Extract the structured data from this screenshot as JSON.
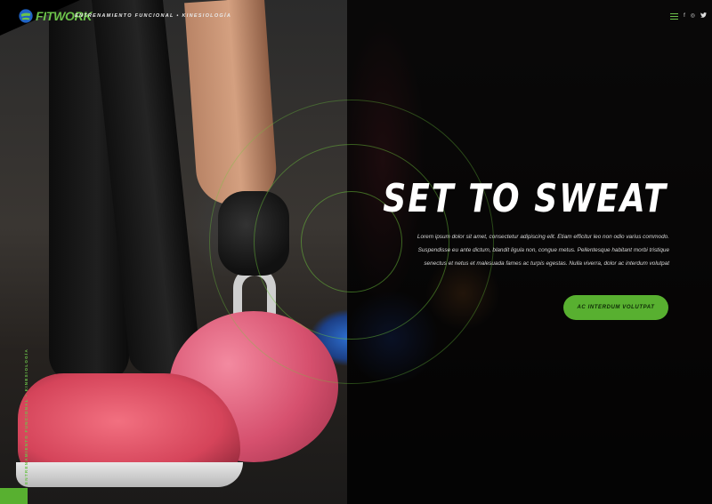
{
  "brand": {
    "logo_text": "FITWORK",
    "tagline": "Entrenamiento Funcional • Kinesiología",
    "accent_color": "#58b030"
  },
  "header": {
    "menu_icon": "hamburger-menu-icon",
    "social": [
      {
        "name": "facebook-icon",
        "glyph": "f"
      },
      {
        "name": "instagram-icon",
        "glyph": "◎"
      },
      {
        "name": "twitter-icon",
        "glyph": "🐦"
      }
    ]
  },
  "side": {
    "vertical_text": "Entrenamiento Funcional • Kinesiología"
  },
  "hero": {
    "title": "SET TO SWEAT",
    "description": "Lorem ipsum dolor sit amet, consectetur adipiscing elit. Etiam efficitur leo non odio varius commodo. Suspendisse eu ante dictum, blandit ligula non, congue metus. Pellentesque habitant morbi tristique senectus et netus et malesuada fames ac turpis egestas. Nulla viverra, dolor ac interdum volutpat",
    "cta_label": "AC INTERDUM VOLUTPAT"
  }
}
